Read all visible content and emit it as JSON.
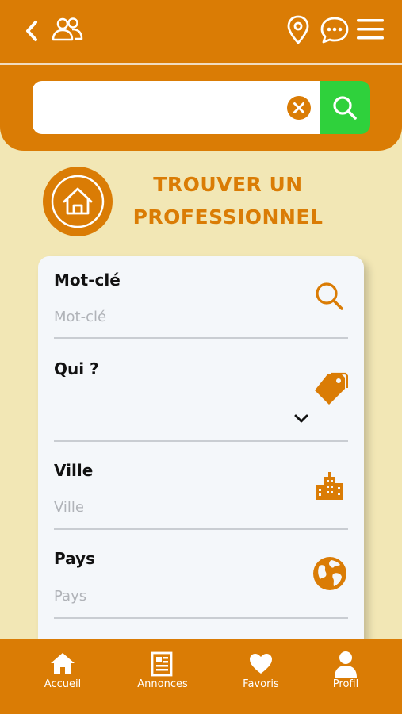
{
  "header": {
    "back_icon": "chevron-left-icon",
    "users_icon": "users-icon",
    "location_icon": "location-pin-icon",
    "chat_icon": "chat-bubble-icon",
    "menu_icon": "hamburger-menu-icon"
  },
  "search": {
    "value": "",
    "placeholder": "",
    "clear_icon": "clear-x-icon",
    "search_icon": "search-icon"
  },
  "page": {
    "title": "TROUVER UN PROFESSIONNEL",
    "home_icon": "home-icon"
  },
  "form": {
    "keyword": {
      "label": "Mot-clé",
      "placeholder": "Mot-clé",
      "icon": "magnifier-icon"
    },
    "who": {
      "label": "Qui ?",
      "value": "",
      "icon": "tags-icon"
    },
    "city": {
      "label": "Ville",
      "placeholder": "Ville",
      "icon": "buildings-icon"
    },
    "country": {
      "label": "Pays",
      "placeholder": "Pays",
      "icon": "globe-icon"
    }
  },
  "nav": {
    "home": "Accueil",
    "ads": "Annonces",
    "favorites": "Favoris",
    "profile": "Profil"
  },
  "colors": {
    "primary": "#DA7C05",
    "background": "#F2E7B5",
    "search_button": "#2FD13C",
    "card": "#F4F7FA"
  }
}
